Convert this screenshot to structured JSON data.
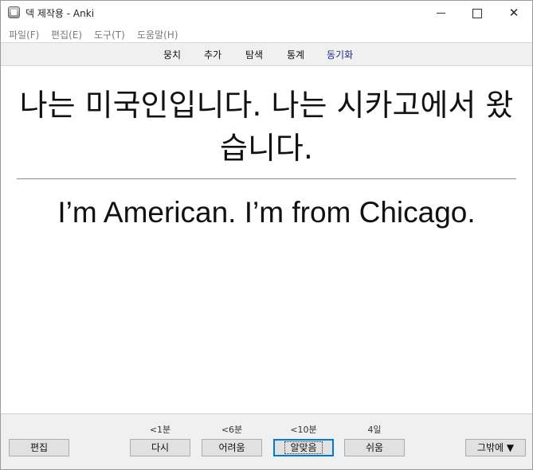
{
  "window": {
    "title": "덱 제작용 - Anki"
  },
  "titlebar_buttons": {
    "minimize": "minimize-icon",
    "maximize": "maximize-icon",
    "close": "close-icon",
    "close_glyph": "✕"
  },
  "menu": {
    "items": [
      {
        "label": "파일(F)"
      },
      {
        "label": "편집(E)"
      },
      {
        "label": "도구(T)"
      },
      {
        "label": "도움말(H)"
      }
    ]
  },
  "toolbar": {
    "items": [
      {
        "label": "뭉치"
      },
      {
        "label": "추가"
      },
      {
        "label": "탐색"
      },
      {
        "label": "통계"
      },
      {
        "label": "동기화"
      }
    ]
  },
  "card": {
    "front": "나는 미국인입니다. 나는 시카고에서 왔습니다.",
    "back": "I’m American.  I’m from Chicago."
  },
  "answer_bar": {
    "edit_label": "편집",
    "more_label": "그밖에 ▼",
    "answers": [
      {
        "label": "다시",
        "interval": "<1분"
      },
      {
        "label": "어려움",
        "interval": "<6분"
      },
      {
        "label": "알맞음",
        "interval": "<10분"
      },
      {
        "label": "쉬움",
        "interval": "4일"
      }
    ]
  },
  "colors": {
    "sync_link": "#1d2a8c",
    "default_button_border": "#0078d7"
  }
}
